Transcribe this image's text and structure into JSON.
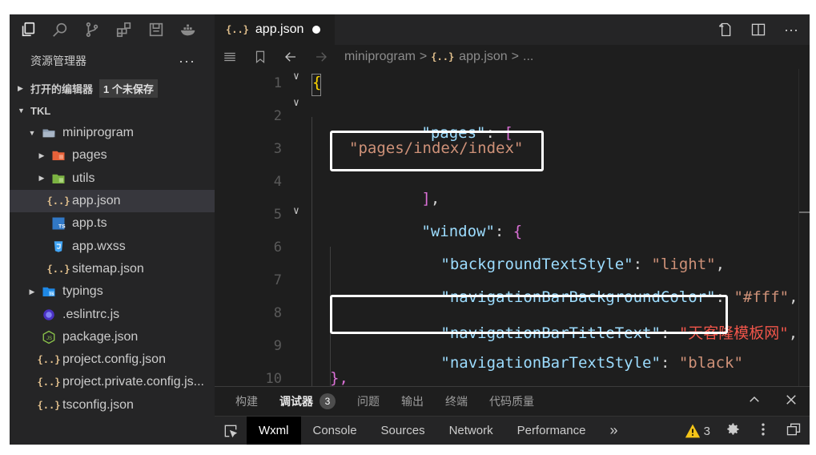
{
  "sidebar": {
    "title": "资源管理器",
    "more_label": "···",
    "open_editors": {
      "label": "打开的编辑器",
      "badge": "1 个未保存"
    },
    "root_label": "TKL",
    "items": [
      {
        "label": "miniprogram",
        "icon": "folder-open-icon"
      },
      {
        "label": "pages",
        "icon": "folder-pages-icon"
      },
      {
        "label": "utils",
        "icon": "folder-utils-icon"
      },
      {
        "label": "app.json",
        "icon": "json-icon"
      },
      {
        "label": "app.ts",
        "icon": "ts-icon"
      },
      {
        "label": "app.wxss",
        "icon": "css-icon"
      },
      {
        "label": "sitemap.json",
        "icon": "json-icon"
      },
      {
        "label": "typings",
        "icon": "folder-typings-icon"
      },
      {
        "label": ".eslintrc.js",
        "icon": "eslint-icon"
      },
      {
        "label": "package.json",
        "icon": "npm-icon"
      },
      {
        "label": "project.config.json",
        "icon": "json-icon"
      },
      {
        "label": "project.private.config.js...",
        "icon": "json-icon"
      },
      {
        "label": "tsconfig.json",
        "icon": "json-icon"
      }
    ]
  },
  "editor": {
    "tab": {
      "icon_text": "{..}",
      "label": "app.json"
    },
    "breadcrumb": {
      "folder": "miniprogram",
      "sep": ">",
      "icon_text": "{..}",
      "file": "app.json",
      "tail": "..."
    },
    "line_numbers": [
      "1",
      "2",
      "3",
      "4",
      "5",
      "6",
      "7",
      "8",
      "9",
      "10"
    ],
    "code": {
      "open_brace": "{",
      "pages_key": "\"pages\"",
      "colon": ": ",
      "open_bracket": "[",
      "page_value": "\"pages/index/index\"",
      "close_bracket": "]",
      "comma": ",",
      "window_key": "\"window\"",
      "window_open": "{",
      "bg_text_key": "\"backgroundTextStyle\"",
      "bg_text_val": "\"light\"",
      "nav_bg_key": "\"navigationBarBackgroundColor\"",
      "nav_bg_val": "\"#fff\"",
      "nav_title_key": "\"navigationBarTitleText\"",
      "nav_title_val": "\"天客隆模板网\"",
      "nav_text_key": "\"navigationBarTextStyle\"",
      "nav_text_val": "\"black\"",
      "close_brace": "},"
    }
  },
  "panel": {
    "tabs": [
      "构建",
      "调试器",
      "问题",
      "输出",
      "终端",
      "代码质量"
    ],
    "debugger_count": "3",
    "devtools_tabs": [
      "Wxml",
      "Console",
      "Sources",
      "Network",
      "Performance"
    ],
    "more_tabs": "»",
    "warning_count": "3"
  },
  "colors": {
    "key": "#9cdcfe",
    "string": "#ce9178",
    "bracket": "#da70d6",
    "brace": "#ffd700"
  }
}
